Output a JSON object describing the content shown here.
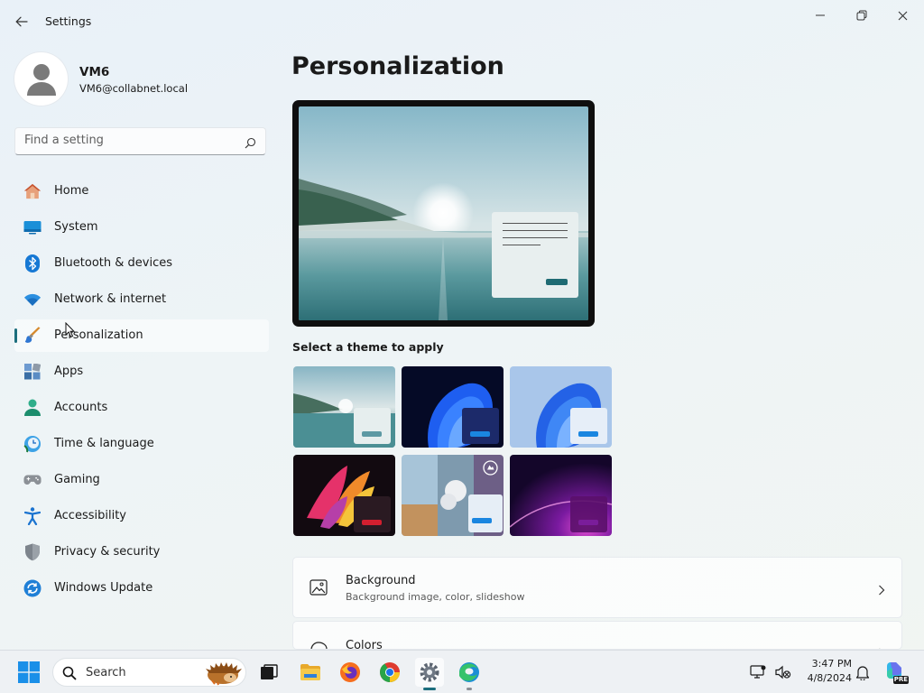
{
  "window": {
    "title": "Settings",
    "icons": {
      "back": "back-arrow-icon",
      "minimize": "minimize-icon",
      "maximize": "restore-icon",
      "close": "close-icon"
    }
  },
  "profile": {
    "name": "VM6",
    "email": "VM6@collabnet.local",
    "icon": "user-avatar-icon"
  },
  "search": {
    "placeholder": "Find a setting",
    "icon": "search-icon"
  },
  "nav": {
    "items": [
      {
        "label": "Home",
        "icon": "home-icon",
        "selected": false
      },
      {
        "label": "System",
        "icon": "system-monitor-icon",
        "selected": false
      },
      {
        "label": "Bluetooth & devices",
        "icon": "bluetooth-icon",
        "selected": false
      },
      {
        "label": "Network & internet",
        "icon": "wifi-icon",
        "selected": false
      },
      {
        "label": "Personalization",
        "icon": "paintbrush-icon",
        "selected": true
      },
      {
        "label": "Apps",
        "icon": "apps-icon",
        "selected": false
      },
      {
        "label": "Accounts",
        "icon": "accounts-icon",
        "selected": false
      },
      {
        "label": "Time & language",
        "icon": "clock-globe-icon",
        "selected": false
      },
      {
        "label": "Gaming",
        "icon": "gamepad-icon",
        "selected": false
      },
      {
        "label": "Accessibility",
        "icon": "accessibility-icon",
        "selected": false
      },
      {
        "label": "Privacy & security",
        "icon": "shield-icon",
        "selected": false
      },
      {
        "label": "Windows Update",
        "icon": "update-icon",
        "selected": false
      }
    ]
  },
  "main": {
    "title": "Personalization",
    "theme_section_label": "Select a theme to apply",
    "themes": [
      {
        "id": "theme-glow-lake",
        "style": "light"
      },
      {
        "id": "theme-bloom-dark",
        "style": "dark"
      },
      {
        "id": "theme-bloom-light",
        "style": "light"
      },
      {
        "id": "theme-flower",
        "style": "dark"
      },
      {
        "id": "theme-spotlight",
        "style": "light"
      },
      {
        "id": "theme-purple-glow",
        "style": "dark"
      }
    ],
    "rows": [
      {
        "title": "Background",
        "subtitle": "Background image, color, slideshow",
        "icon": "background-image-icon"
      },
      {
        "title": "Colors",
        "subtitle": "",
        "icon": "colors-palette-icon"
      }
    ]
  },
  "taskbar": {
    "search_label": "Search",
    "time": "3:47 PM",
    "date": "4/8/2024",
    "apps": [
      "start-icon",
      "task-view-icon",
      "file-explorer-icon",
      "firefox-icon",
      "chrome-icon",
      "settings-icon",
      "edge-icon"
    ],
    "tray": [
      "network-display-icon",
      "sound-muted-icon",
      "notification-bell-icon",
      "copilot-pre-icon"
    ],
    "copilot_badge": "PRE"
  },
  "colors": {
    "accent": "#1c6e7d",
    "windows_blue": "#0a7fd6"
  }
}
